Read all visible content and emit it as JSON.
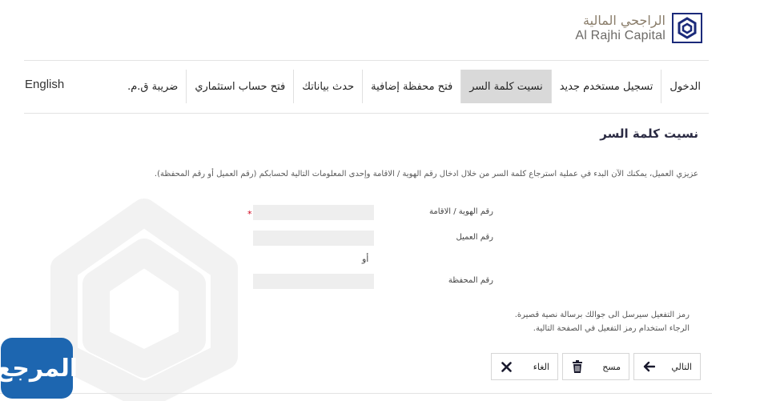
{
  "logo": {
    "arabic_name": "الراجحي المالية",
    "english_name": "Al Rajhi Capital"
  },
  "nav": {
    "items": [
      {
        "label": "الدخول",
        "active": false
      },
      {
        "label": "تسجيل مستخدم جديد",
        "active": false
      },
      {
        "label": "نسيت كلمة السر",
        "active": true
      },
      {
        "label": "فتح محفظة إضافية",
        "active": false
      },
      {
        "label": "حدث بياناتك",
        "active": false
      },
      {
        "label": "فتح حساب استثماري",
        "active": false
      },
      {
        "label": "ضريبة ق.م.",
        "active": false
      }
    ],
    "language_link": "English"
  },
  "page": {
    "title": "نسيت كلمة السر",
    "intro": "عزيزي العميل، يمكنك الآن البدء في عملية استرجاع كلمة السر من خلال ادخال رقم الهوية / الاقامة وإحدى المعلومات التالية لحسابكم (رقم العميل أو رقم المحفظة)."
  },
  "form": {
    "id_label": "رقم الهوية / الاقامة",
    "id_value": "",
    "required_mark": "*",
    "customer_label": "رقم العميل",
    "customer_value": "",
    "or_text": "أو",
    "portfolio_label": "رقم المحفظة",
    "portfolio_value": ""
  },
  "notes": {
    "line1": "رمز التفعيل سيرسل الى جوالك برسالة نصية قصيرة.",
    "line2": "الرجاء استخدام رمز التفعيل في الصفحة التالية."
  },
  "buttons": {
    "next_label": "التالي",
    "clear_label": "مسح",
    "cancel_label": "الغاء"
  },
  "icons": {
    "next": "arrow-left-icon",
    "clear": "trash-icon",
    "cancel": "close-icon"
  },
  "badge": {
    "text": "المرجع"
  },
  "colors": {
    "brand_blue": "#1b2a7a",
    "active_tab": "#d9d9d9",
    "required": "#d0021b",
    "input_bg": "#eeeeee"
  }
}
